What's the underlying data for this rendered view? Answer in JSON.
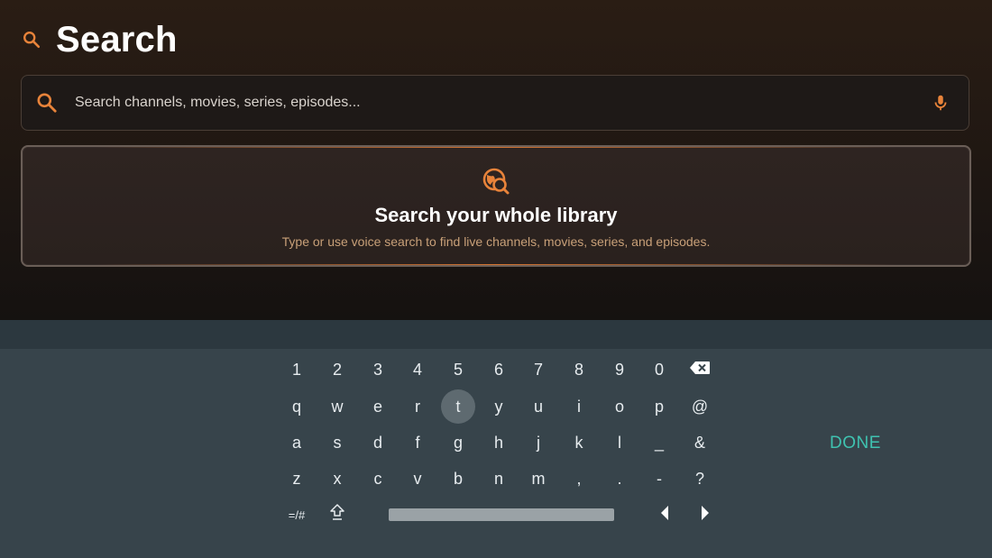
{
  "header": {
    "title": "Search",
    "icon": "search-icon"
  },
  "search": {
    "placeholder": "Search channels, movies, series, episodes...",
    "value": "",
    "leading_icon": "search-icon",
    "trailing_icon": "mic-icon"
  },
  "empty_state": {
    "icon": "library-search-icon",
    "title": "Search your whole library",
    "subtitle": "Type or use voice search to find live channels, movies, series, and episodes."
  },
  "keyboard": {
    "rows": [
      [
        "1",
        "2",
        "3",
        "4",
        "5",
        "6",
        "7",
        "8",
        "9",
        "0",
        "⌫"
      ],
      [
        "q",
        "w",
        "e",
        "r",
        "t",
        "y",
        "u",
        "i",
        "o",
        "p",
        "@"
      ],
      [
        "a",
        "s",
        "d",
        "f",
        "g",
        "h",
        "j",
        "k",
        "l",
        "_",
        "&"
      ],
      [
        "z",
        "x",
        "c",
        "v",
        "b",
        "n",
        "m",
        ",",
        ".",
        "-",
        "?"
      ]
    ],
    "focused_key": "t",
    "symbols_label": "=/#",
    "shift_icon": "shift-icon",
    "left_icon": "arrow-left-icon",
    "right_icon": "arrow-right-icon",
    "backspace_icon": "backspace-icon",
    "done_label": "DONE"
  },
  "colors": {
    "accent": "#e8833a",
    "done": "#3fc2b0",
    "keyboard_bg": "#37444b",
    "key_focus_bg": "#5e6a70"
  }
}
